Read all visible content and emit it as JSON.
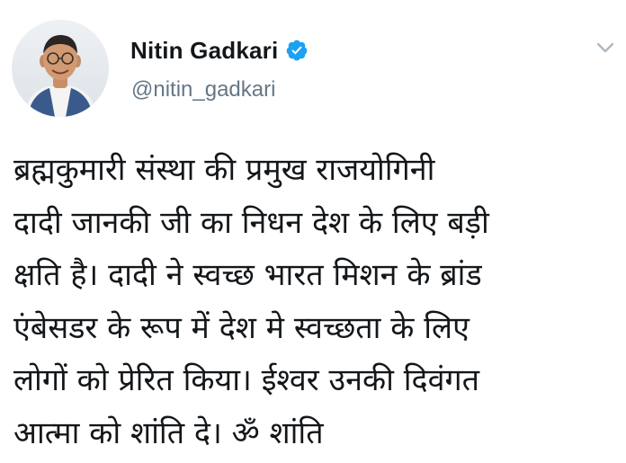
{
  "author": {
    "display_name": "Nitin Gadkari",
    "handle": "@nitin_gadkari",
    "verified": true
  },
  "tweet": {
    "lines": [
      "ब्रह्मकुमारी संस्था की प्रमुख राजयोगिनी",
      "दादी जानकी जी का निधन देश के लिए बड़ी",
      "क्षति है। दादी ने स्वच्छ भारत मिशन के ब्रांड",
      "एंबेसडर के रूप में देश मे स्वच्छता के लिए",
      "लोगों को प्रेरित किया। ईश्वर उनकी दिवंगत",
      "आत्मा को शांति दे। ॐ शांति"
    ]
  },
  "icons": {
    "verified": "verified-badge-icon",
    "menu": "chevron-down-icon",
    "avatar": "profile-photo"
  },
  "colors": {
    "verified_badge": "#1da1f2",
    "handle": "#657786",
    "text": "#14171a",
    "chevron": "#aab8c2"
  }
}
